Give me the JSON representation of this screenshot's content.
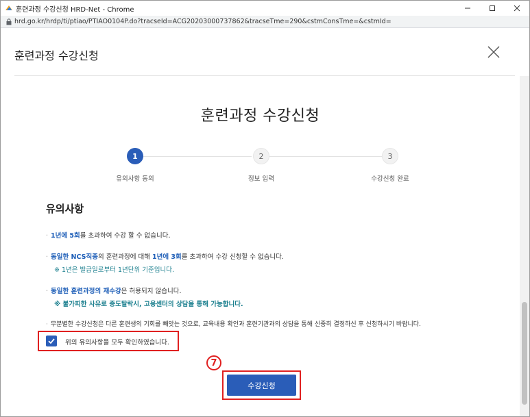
{
  "window": {
    "title": "훈련과정 수강신청 HRD-Net - Chrome",
    "url": "hrd.go.kr/hrdp/ti/ptiao/PTIAO0104P.do?tracseId=ACG20203000737862&tracseTme=290&cstmConsTme=&cstmId="
  },
  "modal": {
    "title": "훈련과정 수강신청"
  },
  "page": {
    "title": "훈련과정 수강신청"
  },
  "steps": [
    {
      "number": "1",
      "label": "유의사항 동의"
    },
    {
      "number": "2",
      "label": "정보 입력"
    },
    {
      "number": "3",
      "label": "수강신청 완료"
    }
  ],
  "notices": {
    "heading": "유의사항",
    "n1_blue": "1년에 5회",
    "n1_rest": "를 초과하여 수강 할 수 없습니다.",
    "n2_blue1": "동일한 NCS직종",
    "n2_mid": "의 훈련과정에 대해 ",
    "n2_blue2": "1년에 3회",
    "n2_rest": "를 초과하여 수강 신청할 수 없습니다.",
    "n2_sub": "※ 1년은 발급일로부터 1년단위 기준입니다.",
    "n3_blue": "동일한 훈련과정의 재수강",
    "n3_rest": "은 허용되지 않습니다.",
    "n3_sub": "※ 불가피한 사유로 중도탈락시, 고용센터의 상담을 통해 가능합니다.",
    "n4": "무분별한 수강신청은 다른 훈련생의 기회를 빼앗는 것으로, 교육내용 확인과 훈련기관과의 상담을 통해 신중히 결정하신 후 신청하시기 바랍니다."
  },
  "agree": {
    "label": "위의 유의사항을 모두 확인하였습니다.",
    "checked": true
  },
  "annotation": {
    "badge": "7"
  },
  "submit": {
    "label": "수강신청"
  },
  "colors": {
    "accent": "#2a5db8",
    "highlight": "#1f5fb8",
    "sub_note": "#1b7f8e",
    "annotation_red": "#e02020"
  }
}
